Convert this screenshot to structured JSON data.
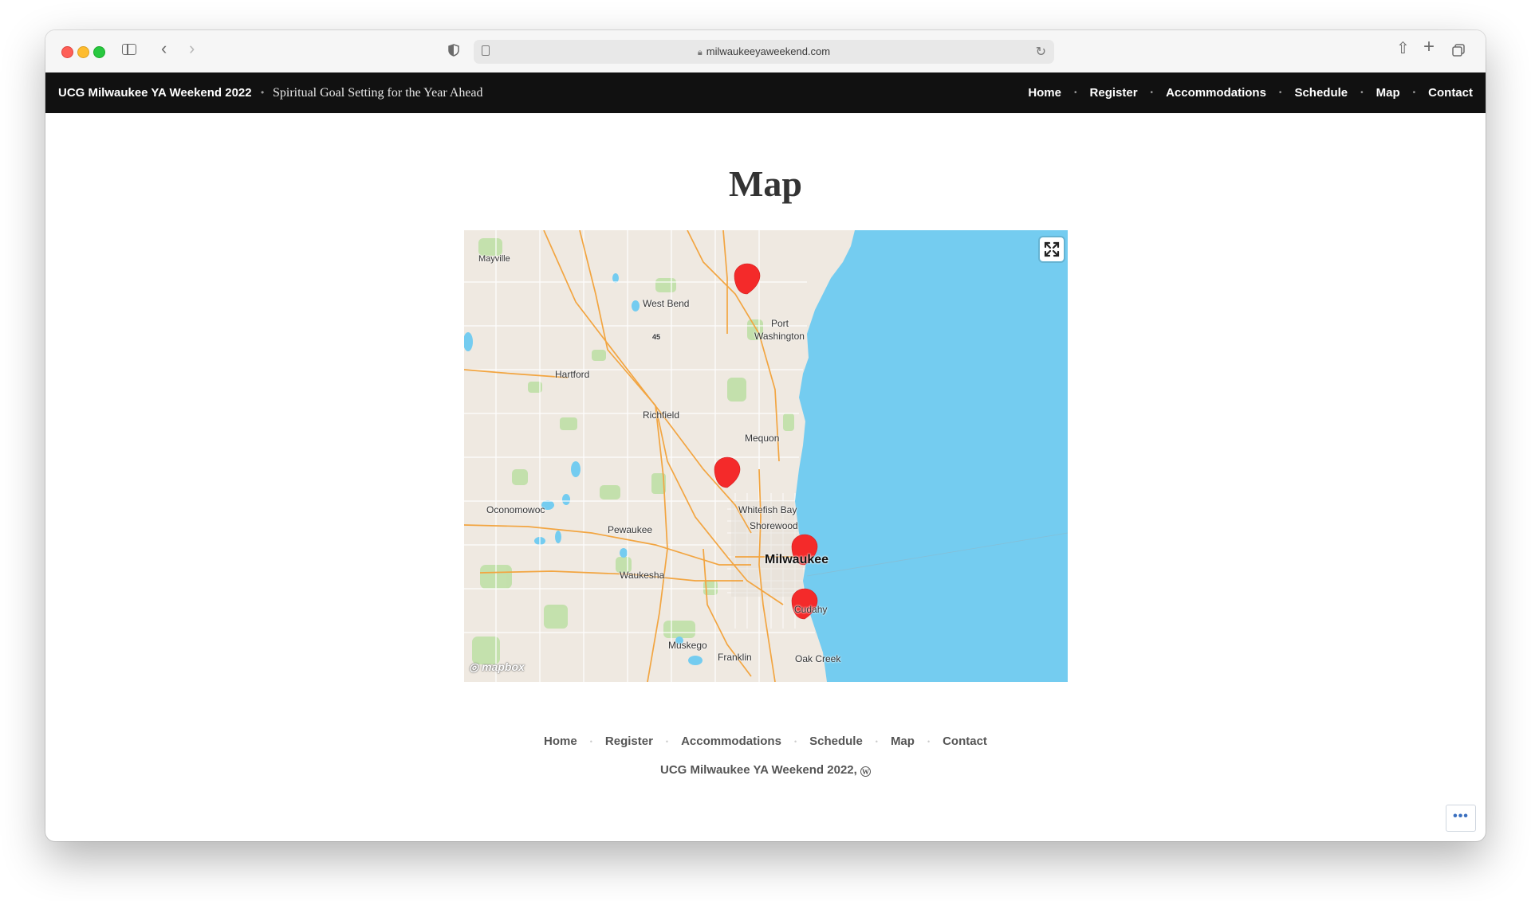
{
  "browser": {
    "url": "milwaukeeyaweekend.com"
  },
  "site": {
    "title": "UCG Milwaukee YA Weekend 2022",
    "tagline": "Spiritual Goal Setting for the Year Ahead",
    "nav": [
      "Home",
      "Register",
      "Accommodations",
      "Schedule",
      "Map",
      "Contact"
    ]
  },
  "page": {
    "title": "Map"
  },
  "map": {
    "labels": {
      "mayville": "Mayville",
      "west_bend": "West Bend",
      "port": "Port",
      "washington": "Washington",
      "hartford": "Hartford",
      "hwy45": "45",
      "richfield": "Richfield",
      "mequon": "Mequon",
      "oconomowoc": "Oconomowoc",
      "whitefish_bay": "Whitefish Bay",
      "shorewood": "Shorewood",
      "pewaukee": "Pewaukee",
      "milwaukee": "Milwaukee",
      "waukesha": "Waukesha",
      "cudahy": "Cudahy",
      "muskego": "Muskego",
      "franklin": "Franklin",
      "oak_creek": "Oak Creek"
    },
    "attribution": "mapbox",
    "marker_color": "#f42a2a",
    "water_color": "#74ccf0",
    "land_color": "#efe9e1"
  },
  "footer": {
    "nav": [
      "Home",
      "Register",
      "Accommodations",
      "Schedule",
      "Map",
      "Contact"
    ],
    "copyright": "UCG Milwaukee YA Weekend 2022,",
    "wp_glyph": "W",
    "more_glyph": "•••"
  }
}
